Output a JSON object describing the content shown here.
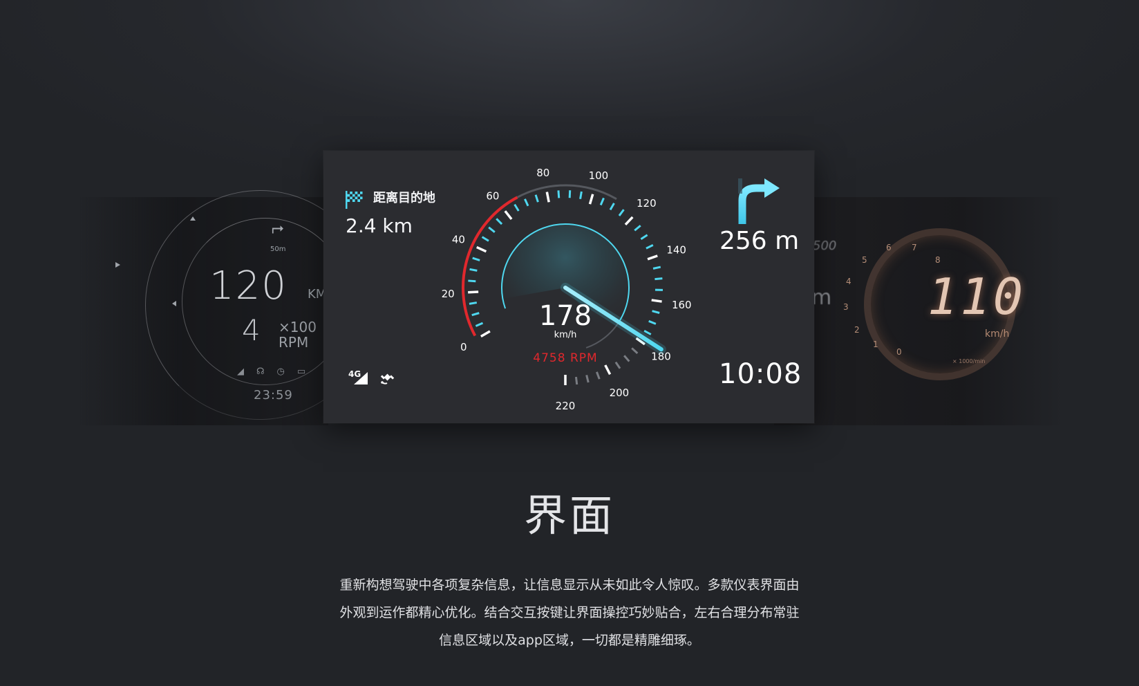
{
  "left_dashboard": {
    "speed": "120",
    "speed_unit": "KM",
    "gear": "4",
    "rpm_multiplier": "×100",
    "rpm_label": "RPM",
    "nav_distance": "50m",
    "clock": "23:59"
  },
  "main_dashboard": {
    "destination": {
      "label": "距离目的地",
      "distance": "2.4 km"
    },
    "turn": {
      "distance": "256 m",
      "direction": "right-turn"
    },
    "clock": "10:08",
    "network": "4G",
    "gauge": {
      "speed": "178",
      "speed_unit": "km/h",
      "rpm_text": "4758 RPM",
      "scale_labels": [
        "0",
        "20",
        "40",
        "60",
        "80",
        "100",
        "120",
        "140",
        "160",
        "180",
        "200",
        "220"
      ],
      "value": 178,
      "max": 220,
      "accent_color": "#4fd8f0",
      "rpm_color": "#e0282d"
    }
  },
  "right_dashboard": {
    "speed": "110",
    "speed_unit": "km/h",
    "rpm_unit": "× 1000/min",
    "odometer": "500",
    "tach_labels": [
      "0",
      "1",
      "2",
      "3",
      "4",
      "5",
      "6",
      "7",
      "8"
    ]
  },
  "section": {
    "title": "界面",
    "body_line1": "重新构想驾驶中各项复杂信息，让信息显示从未如此令人惊叹。多款仪表界面由",
    "body_line2": "外观到运作都精心优化。结合交互按键让界面操控巧妙贴合，左右合理分布常驻",
    "body_line3": "信息区域以及app区域，一切都是精雕细琢。"
  }
}
